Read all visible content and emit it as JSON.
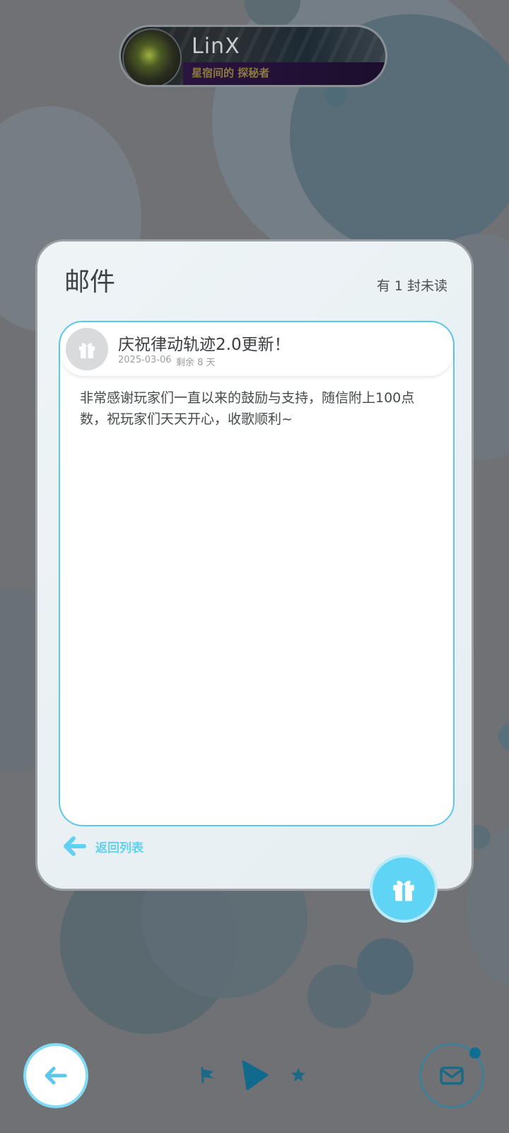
{
  "profile": {
    "name": "LinX",
    "title": "星宿间的 探秘者"
  },
  "mailbox": {
    "title": "邮件",
    "unread_text": "有 1 封未读"
  },
  "mail": {
    "subject": "庆祝律动轨迹2.0更新！",
    "date": "2025-03-06",
    "remaining": "剩余 8 天",
    "body": "非常感谢玩家们一直以来的鼓励与支持，随信附上100点数，祝玩家们天天开心，收歌顺利~"
  },
  "back_to_list_label": "返回列表",
  "colors": {
    "accent": "#5fd4f4",
    "border_accent": "#5cc7e8",
    "background": "#6f7175",
    "card": "#eef4f6",
    "badge": "#0f6e92"
  },
  "icons": {
    "mail_gift": "gift-icon",
    "claim": "gift-icon",
    "back_list": "arrow-left-icon",
    "back": "arrow-left-icon",
    "flag": "flag-icon",
    "play": "play-icon",
    "star": "star-icon",
    "mailbox": "envelope-icon"
  }
}
